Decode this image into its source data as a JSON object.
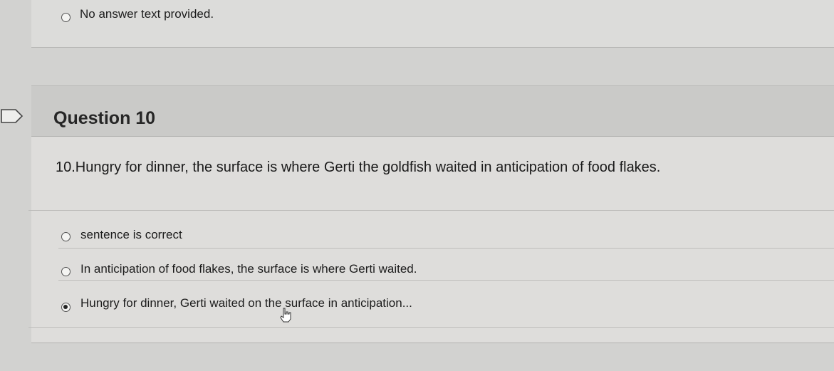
{
  "previous_question": {
    "option_text": "No answer text provided."
  },
  "question": {
    "title": "Question 10",
    "text": "10.Hungry for dinner, the surface is where Gerti the goldfish waited in anticipation of food flakes.",
    "options": [
      {
        "label": "sentence is correct",
        "selected": false
      },
      {
        "label": "In anticipation of food flakes, the surface is where Gerti waited.",
        "selected": false
      },
      {
        "label": "Hungry for dinner, Gerti waited on the surface in anticipation...",
        "selected": true
      }
    ]
  },
  "icons": {
    "flag": "flag-question-icon",
    "cursor": "hand-pointer-cursor-icon"
  },
  "colors": {
    "page_bg": "#d2d2d0",
    "card_bg": "#dedddb",
    "header_bg": "#cacac8"
  }
}
